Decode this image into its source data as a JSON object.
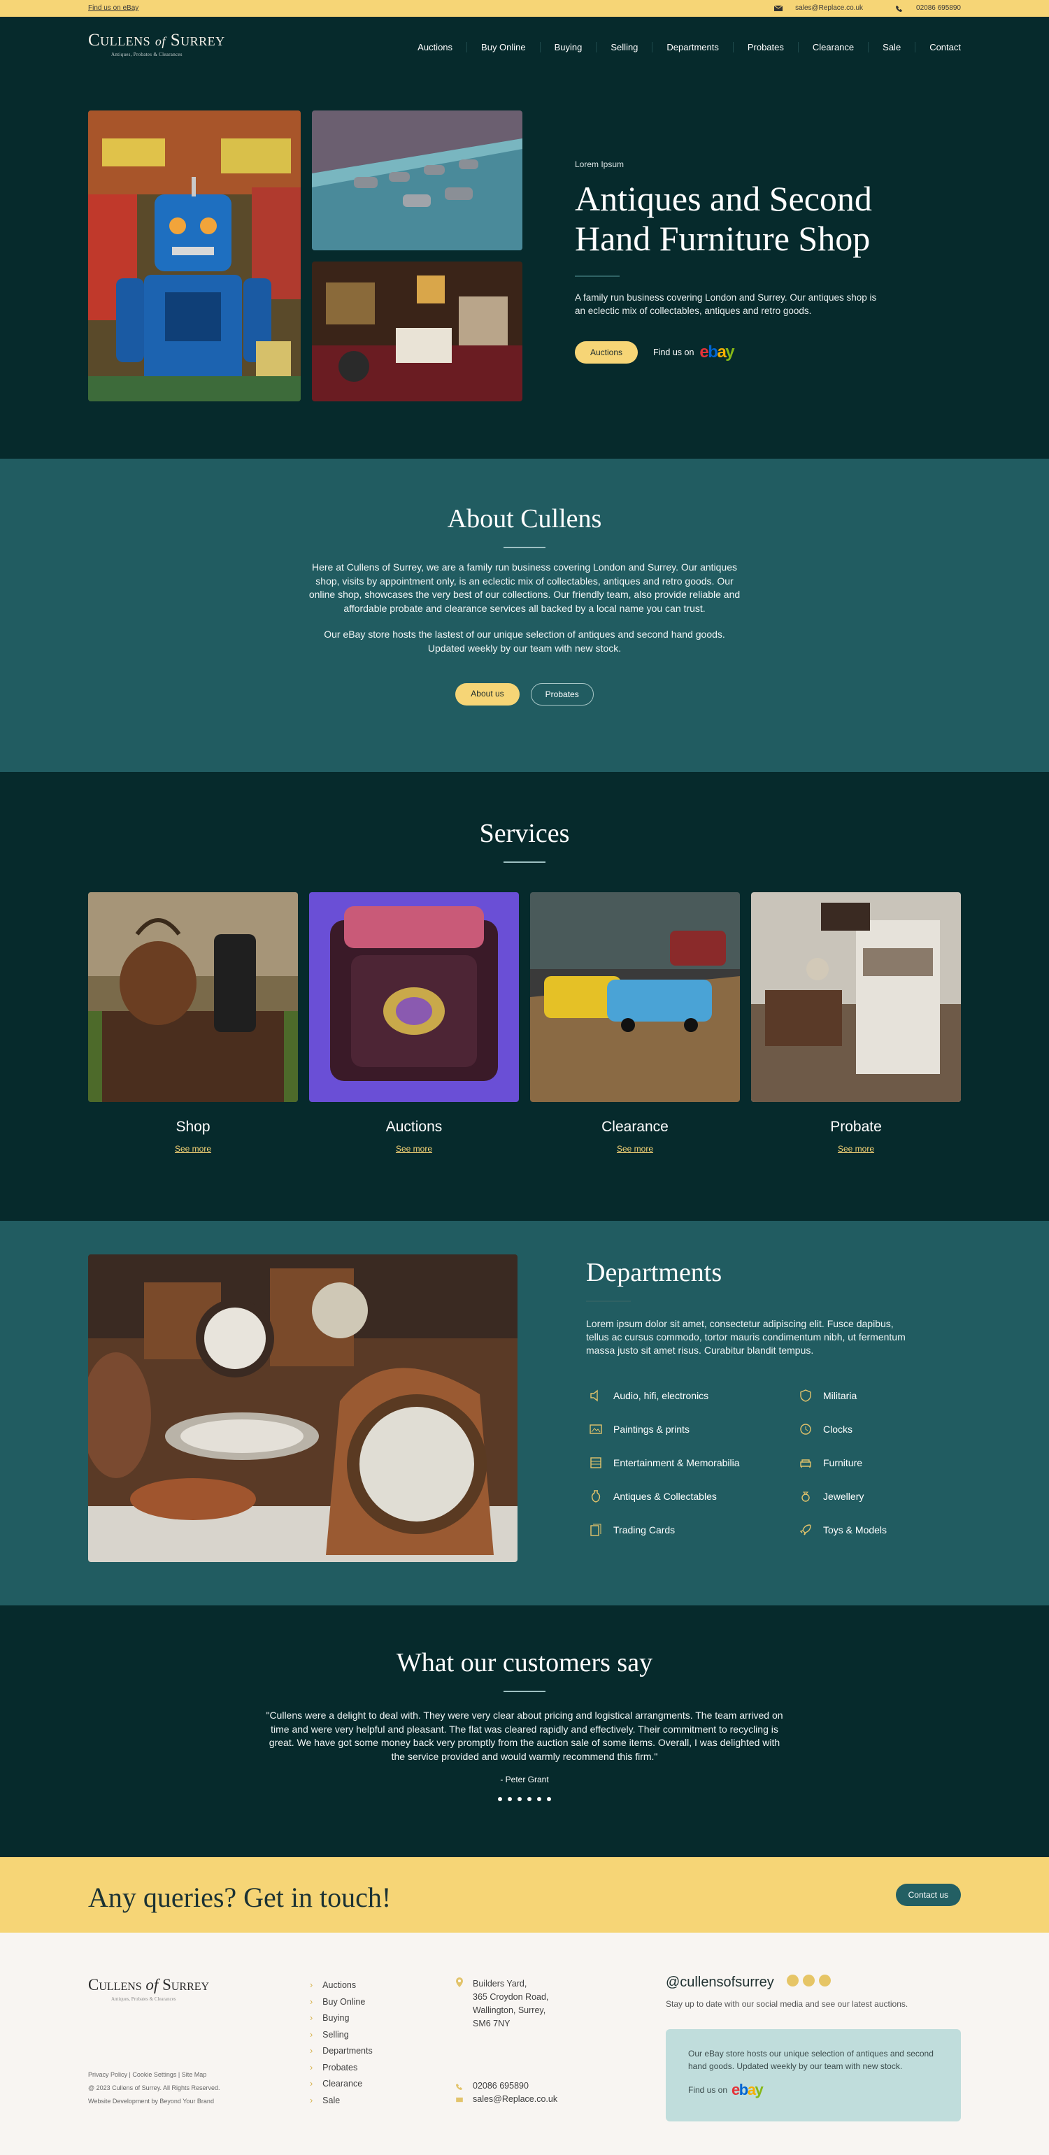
{
  "topbar": {
    "ebay_link": "Find us on eBay",
    "email": "sales@Replace.co.uk",
    "phone": "02086 695890"
  },
  "brand": {
    "name_a": "Cullens",
    "name_of": "of",
    "name_b": "Surrey",
    "tagline": "Antiques, Probates & Clearances"
  },
  "nav": {
    "items": [
      "Auctions",
      "Buy Online",
      "Buying",
      "Selling",
      "Departments",
      "Probates",
      "Clearance",
      "Sale",
      "Contact"
    ]
  },
  "hero": {
    "eyebrow": "Lorem Ipsum",
    "title": "Antiques and Second Hand Furniture Shop",
    "text": "A family run business covering London and Surrey. Our antiques shop is an eclectic mix of collectables, antiques and retro goods.",
    "button": "Auctions",
    "find_us": "Find us on"
  },
  "about": {
    "title": "About Cullens",
    "p1": "Here at Cullens of Surrey, we are a family run business covering London and Surrey. Our antiques shop, visits by appointment only, is an eclectic mix of collectables, antiques and retro goods. Our online shop, showcases the very best of our collections. Our friendly team, also provide reliable and affordable probate and clearance services all backed by a local name you can trust.",
    "p2": "Our eBay store hosts the lastest of our unique selection of antiques and second hand goods. Updated weekly by our team with new stock.",
    "btn1": "About us",
    "btn2": "Probates"
  },
  "services": {
    "title": "Services",
    "cards": [
      {
        "title": "Shop",
        "more": "See more"
      },
      {
        "title": "Auctions",
        "more": "See more"
      },
      {
        "title": "Clearance",
        "more": "See more"
      },
      {
        "title": "Probate",
        "more": "See more"
      }
    ]
  },
  "departments": {
    "title": "Departments",
    "text": "Lorem ipsum dolor sit amet, consectetur adipiscing elit. Fusce dapibus, tellus ac cursus commodo, tortor mauris condimentum nibh, ut fermentum massa justo sit amet risus. Curabitur blandit tempus.",
    "items": [
      "Audio, hifi, electronics",
      "Militaria",
      "Paintings & prints",
      "Clocks",
      "Entertainment & Memorabilia",
      "Furniture",
      "Antiques & Collectables",
      "Jewellery",
      "Trading Cards",
      "Toys & Models"
    ]
  },
  "testimonials": {
    "title": "What our customers say",
    "quote": "\"Cullens were a delight to deal with. They were very clear about pricing and logistical arrangments. The team arrived on time and were very helpful and pleasant. The flat was cleared rapidly and effectively. Their commitment to recycling is great. We have got some money back very promptly from the auction sale of some items. Overall, I was delighted with the service provided and would warmly recommend this firm.\"",
    "author": "- Peter Grant"
  },
  "cta": {
    "title": "Any queries? Get in touch!",
    "button": "Contact us"
  },
  "footer": {
    "legal_links": "Privacy Policy  |  Cookie Settings  |  Site Map",
    "copyright": "@ 2023 Cullens of Surrey. All Rights Reserved.",
    "credit": "Website Development by Beyond Your Brand",
    "links": [
      "Auctions",
      "Buy Online",
      "Buying",
      "Selling",
      "Departments",
      "Probates",
      "Clearance",
      "Sale"
    ],
    "address": [
      "Builders Yard,",
      "365 Croydon Road,",
      "Wallington, Surrey,",
      "SM6 7NY"
    ],
    "phone": "02086 695890",
    "email": "sales@Replace.co.uk",
    "social_handle": "@cullensofsurrey",
    "social_sub": "Stay up to date with our social media and see our latest auctions.",
    "ebay_text": "Our eBay store hosts our unique selection of antiques and second hand goods. Updated weekly by our team with new stock.",
    "find_us": "Find us on"
  },
  "colors": {
    "dark": "#062a2c",
    "teal": "#215c61",
    "gold": "#f6d576",
    "footer": "#f8f5f2"
  }
}
